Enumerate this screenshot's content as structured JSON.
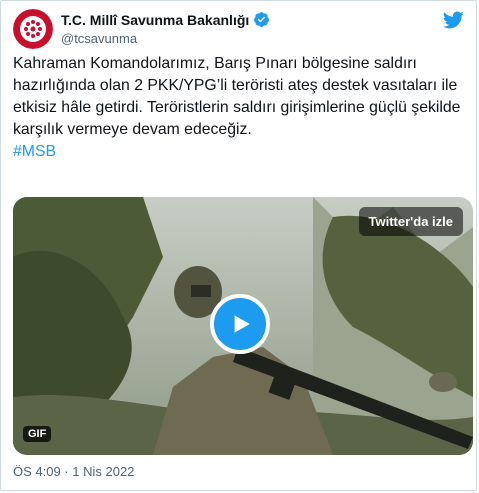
{
  "account": {
    "name": "T.C. Millî Savunma Bakanlığı",
    "handle": "@tcsavunma"
  },
  "icons": {
    "avatar": "msb-emblem-icon",
    "verified": "verified-badge-icon",
    "platform": "twitter-bird-icon",
    "play": "play-icon"
  },
  "tweet": {
    "text": "Kahraman Komandolarımız, Barış Pınarı bölgesine saldırı hazırlığında olan 2 PKK/YPG’li teröristi ateş destek vasıtaları ile etkisiz hâle getirdi. Teröristlerin saldırı girişimlerine güçlü şekilde karşılık vermeye devam edeceğiz.",
    "hashtag": "#MSB"
  },
  "media": {
    "watch_label": "Twitter'da izle",
    "badge": "GIF"
  },
  "timestamp": "ÖS 4:09 · 1 Nis 2022",
  "colors": {
    "accent": "#1d9bf0",
    "text": "#0f1419",
    "secondary": "#536471",
    "avatar_red": "#c8102e"
  }
}
